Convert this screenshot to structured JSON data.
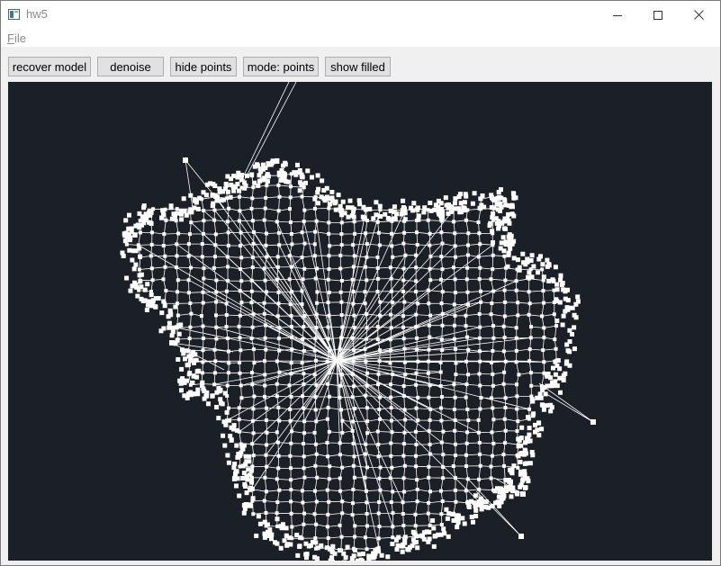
{
  "window": {
    "title": "hw5",
    "controls": {
      "minimize": "minimize-icon",
      "maximize": "maximize-icon",
      "close": "close-icon"
    }
  },
  "menubar": {
    "items": [
      {
        "label": "File",
        "mnemonic": "F",
        "rest": "ile"
      }
    ]
  },
  "toolbar": {
    "buttons": [
      {
        "id": "recover-model",
        "label": "recover model"
      },
      {
        "id": "denoise",
        "label": "denoise"
      },
      {
        "id": "hide-points",
        "label": "hide points"
      },
      {
        "id": "mode",
        "label": "mode: points"
      },
      {
        "id": "show-filled",
        "label": "show filled"
      }
    ]
  },
  "viewport": {
    "background": "#1b1f26",
    "mesh_color": "#ffffff",
    "content": "triangulated point-cloud mesh"
  }
}
